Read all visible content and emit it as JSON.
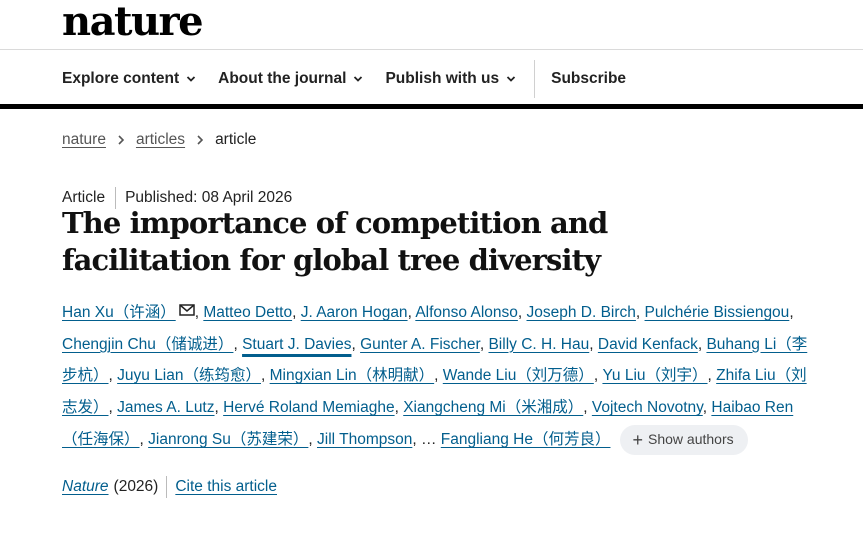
{
  "brand": {
    "logo_text": "nature"
  },
  "nav": {
    "items": [
      "Explore content",
      "About the journal",
      "Publish with us"
    ],
    "subscribe": "Subscribe"
  },
  "breadcrumb": {
    "items": [
      "nature",
      "articles"
    ],
    "current": "article"
  },
  "article": {
    "type": "Article",
    "published": "Published: 08 April 2026",
    "title": "The importance of competition and facilitation for global tree diversity"
  },
  "authors": {
    "list": [
      "Han Xu（许涵）",
      "Matteo Detto",
      "J. Aaron Hogan",
      "Alfonso Alonso",
      "Joseph D. Birch",
      "Pulchérie Bissiengou",
      "Chengjin Chu（储诚进）",
      "Stuart J. Davies",
      "Gunter A. Fischer",
      "Billy C. H. Hau",
      "David Kenfack",
      "Buhang Li（李步杭）",
      "Juyu Lian（练筠愈）",
      "Mingxian Lin（林明献）",
      "Wande Liu（刘万德）",
      "Yu Liu（刘宇）",
      "Zhifa Liu（刘志发）",
      "James A. Lutz",
      "Hervé Roland Memiaghe",
      "Xiangcheng Mi（米湘成）",
      "Vojtech Novotny",
      "Haibao Ren（任海保）",
      "Jianrong Su（苏建荣）",
      "Jill Thompson"
    ],
    "ellipsis": "…",
    "last": "Fangliang He（何芳良）",
    "show_label": "Show authors",
    "icons": {
      "corresponding": "mail-icon",
      "show": "plus-icon"
    }
  },
  "citation": {
    "journal": "Nature",
    "year": "(2026)",
    "cite_label": "Cite this article"
  },
  "colors": {
    "link": "#025e8d",
    "rule": "#000000",
    "chip_bg": "#eef0f3"
  }
}
